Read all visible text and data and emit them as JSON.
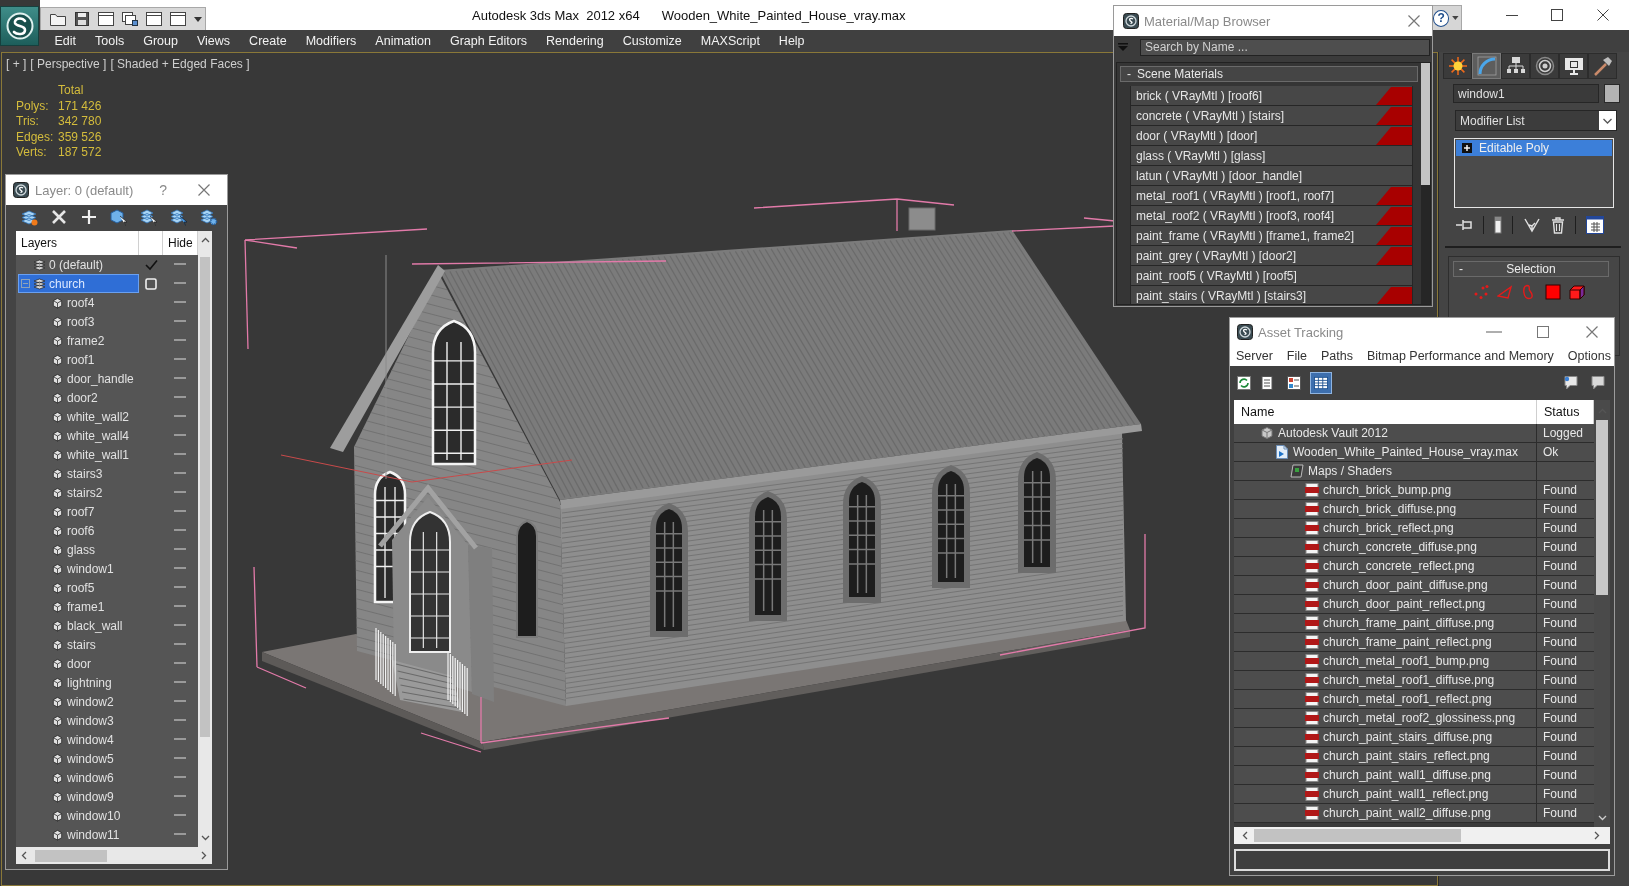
{
  "window": {
    "title": "Autodesk 3ds Max  2012 x64",
    "file_name": "Wooden_White_Painted_House_vray.max",
    "help": "?"
  },
  "menu": [
    "Edit",
    "Tools",
    "Group",
    "Views",
    "Create",
    "Modifiers",
    "Animation",
    "Graph Editors",
    "Rendering",
    "Customize",
    "MAXScript",
    "Help"
  ],
  "viewport": {
    "labels": [
      "[ + ]",
      "[ Perspective ]",
      "[ Shaded + Edged Faces ]"
    ],
    "stats": {
      "heading": "Total",
      "rows": [
        {
          "label": "Polys:",
          "value": "171 426"
        },
        {
          "label": "Tris:",
          "value": "342 780"
        },
        {
          "label": "Edges:",
          "value": "359 526"
        },
        {
          "label": "Verts:",
          "value": "187 572"
        }
      ]
    }
  },
  "layer_explorer": {
    "title": "Layer: 0 (default)",
    "help": "?",
    "columns": [
      "Layers",
      "Hide"
    ],
    "layers": [
      {
        "name": "0 (default)",
        "current": true,
        "selected": false
      },
      {
        "name": "church",
        "current": false,
        "selected": true,
        "expanded": true,
        "children": [
          {
            "name": "roof4",
            "selected": false
          },
          {
            "name": "roof3",
            "selected": false
          },
          {
            "name": "frame2",
            "selected": false
          },
          {
            "name": "roof1",
            "selected": false
          },
          {
            "name": "door_handle",
            "selected": false
          },
          {
            "name": "door2",
            "selected": false
          },
          {
            "name": "white_wall2",
            "selected": false
          },
          {
            "name": "white_wall4",
            "selected": false
          },
          {
            "name": "white_wall1",
            "selected": false
          },
          {
            "name": "stairs3",
            "selected": false
          },
          {
            "name": "stairs2",
            "selected": false
          },
          {
            "name": "roof7",
            "selected": false
          },
          {
            "name": "roof6",
            "selected": false
          },
          {
            "name": "glass",
            "selected": false
          },
          {
            "name": "window1",
            "selected": false
          },
          {
            "name": "roof5",
            "selected": false
          },
          {
            "name": "frame1",
            "selected": false
          },
          {
            "name": "black_wall",
            "selected": false
          },
          {
            "name": "stairs",
            "selected": false
          },
          {
            "name": "door",
            "selected": false
          },
          {
            "name": "lightning",
            "selected": false
          },
          {
            "name": "window2",
            "selected": false
          },
          {
            "name": "window3",
            "selected": false
          },
          {
            "name": "window4",
            "selected": false
          },
          {
            "name": "window5",
            "selected": false
          },
          {
            "name": "window6",
            "selected": false
          },
          {
            "name": "window9",
            "selected": false
          },
          {
            "name": "window10",
            "selected": false
          },
          {
            "name": "window11",
            "selected": false
          }
        ]
      }
    ]
  },
  "material_browser": {
    "title": "Material/Map Browser",
    "search": {
      "placeholder": "Search by Name ..."
    },
    "group": {
      "toggle": "-",
      "label": "Scene Materials"
    },
    "materials": [
      {
        "label": "brick ( VRayMtl ) [roof6]",
        "flagged": true
      },
      {
        "label": "concrete ( VRayMtl ) [stairs]",
        "flagged": true
      },
      {
        "label": "door ( VRayMtl ) [door]",
        "flagged": true
      },
      {
        "label": "glass ( VRayMtl ) [glass]",
        "flagged": false
      },
      {
        "label": "latun ( VRayMtl ) [door_handle]",
        "flagged": false
      },
      {
        "label": "metal_roof1 ( VRayMtl ) [roof1, roof7]",
        "flagged": true
      },
      {
        "label": "metal_roof2 ( VRayMtl ) [roof3, roof4]",
        "flagged": true
      },
      {
        "label": "paint_frame ( VRayMtl ) [frame1, frame2]",
        "flagged": true
      },
      {
        "label": "paint_grey ( VRayMtl ) [door2]",
        "flagged": true
      },
      {
        "label": "paint_roof5 ( VRayMtl ) [roof5]",
        "flagged": false
      },
      {
        "label": "paint_stairs ( VRayMtl ) [stairs3]",
        "flagged": true
      }
    ]
  },
  "command_panel": {
    "tabs": [
      {
        "selected": false
      },
      {
        "selected": true
      },
      {
        "selected": false
      },
      {
        "selected": false
      },
      {
        "selected": false
      },
      {
        "selected": false
      }
    ],
    "object_name": "window1",
    "modifier_list": "Modifier List",
    "stack": [
      {
        "name": "Editable Poly",
        "selected": true,
        "expanded": false
      }
    ],
    "rollout": {
      "toggle": "-",
      "title": "Selection",
      "levels": [
        {
          "selected": false
        },
        {
          "selected": false
        },
        {
          "selected": false
        },
        {
          "selected": false
        },
        {
          "selected": false
        }
      ]
    }
  },
  "asset_tracking": {
    "title": "Asset Tracking",
    "menu": [
      "Server",
      "File",
      "Paths",
      "Bitmap Performance and Memory",
      "Options"
    ],
    "views": [
      {
        "selected": false
      },
      {
        "selected": false
      },
      {
        "selected": true
      }
    ],
    "columns": [
      "Name",
      "Status"
    ],
    "assets": [
      {
        "kind": "vault",
        "name": "Autodesk Vault 2012",
        "status": "Logged",
        "children": [
          {
            "kind": "scene",
            "name": "Wooden_White_Painted_House_vray.max",
            "status": "Ok",
            "children": [
              {
                "kind": "maps",
                "name": "Maps / Shaders",
                "children": [
                  {
                    "kind": "image",
                    "name": "church_brick_bump.png",
                    "status": "Found"
                  },
                  {
                    "kind": "image",
                    "name": "church_brick_diffuse.png",
                    "status": "Found"
                  },
                  {
                    "kind": "image",
                    "name": "church_brick_reflect.png",
                    "status": "Found"
                  },
                  {
                    "kind": "image",
                    "name": "church_concrete_diffuse.png",
                    "status": "Found"
                  },
                  {
                    "kind": "image",
                    "name": "church_concrete_reflect.png",
                    "status": "Found"
                  },
                  {
                    "kind": "image",
                    "name": "church_door_paint_diffuse.png",
                    "status": "Found"
                  },
                  {
                    "kind": "image",
                    "name": "church_door_paint_reflect.png",
                    "status": "Found"
                  },
                  {
                    "kind": "image",
                    "name": "church_frame_paint_diffuse.png",
                    "status": "Found"
                  },
                  {
                    "kind": "image",
                    "name": "church_frame_paint_reflect.png",
                    "status": "Found"
                  },
                  {
                    "kind": "image",
                    "name": "church_metal_roof1_bump.png",
                    "status": "Found"
                  },
                  {
                    "kind": "image",
                    "name": "church_metal_roof1_diffuse.png",
                    "status": "Found"
                  },
                  {
                    "kind": "image",
                    "name": "church_metal_roof1_reflect.png",
                    "status": "Found"
                  },
                  {
                    "kind": "image",
                    "name": "church_metal_roof2_glossiness.png",
                    "status": "Found"
                  },
                  {
                    "kind": "image",
                    "name": "church_paint_stairs_diffuse.png",
                    "status": "Found"
                  },
                  {
                    "kind": "image",
                    "name": "church_paint_stairs_reflect.png",
                    "status": "Found"
                  },
                  {
                    "kind": "image",
                    "name": "church_paint_wall1_diffuse.png",
                    "status": "Found"
                  },
                  {
                    "kind": "image",
                    "name": "church_paint_wall1_reflect.png",
                    "status": "Found"
                  },
                  {
                    "kind": "image",
                    "name": "church_paint_wall2_diffuse.png",
                    "status": "Found"
                  }
                ]
              }
            ]
          }
        ]
      }
    ]
  }
}
